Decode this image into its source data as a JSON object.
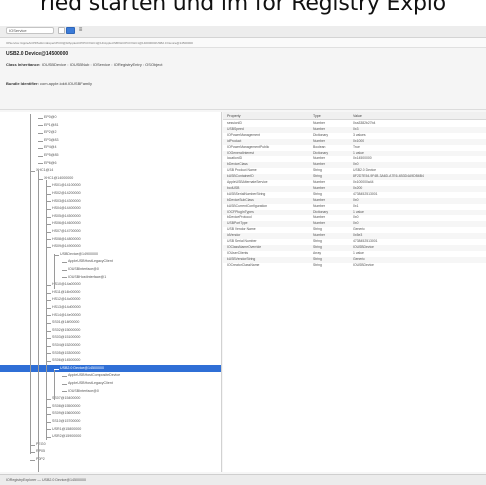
{
  "banner": {
    "text": "ried starten und im for Registry Explo"
  },
  "window": {
    "title": "IORegistryExplorer — IOService"
  },
  "toolbar": {
    "search": "IOService",
    "btn_c": "≡"
  },
  "path_bar": "IOService:/AppleACPIPlatformExpert/PCI0@0/AppleACPIPCI/XHC1@14/AppleUSBXHCIPCI/XHC1@14000000/USB2.0 Device@14500000",
  "device": {
    "title": "USB2.0 Device@14500000",
    "class_label": "Class Inheritance:",
    "class_value": "IOUSBDevice : IOUSBNub : IOService : IORegistryEntry : OSObject",
    "bundle_label": "Bundle Identifier:",
    "bundle_value": "com.apple.iokit.IOUSBFamily"
  },
  "tree": [
    {
      "label": "EP0@0",
      "level": 2
    },
    {
      "label": "EP1@81",
      "level": 2
    },
    {
      "label": "EP2@2",
      "level": 2
    },
    {
      "label": "EP3@83",
      "level": 2
    },
    {
      "label": "EP4@4",
      "level": 2
    },
    {
      "label": "EP5@85",
      "level": 2
    },
    {
      "label": "EP6@6",
      "level": 2
    },
    {
      "label": "XHC1@14",
      "level": 1
    },
    {
      "label": "XHC1@14000000",
      "level": 2
    },
    {
      "label": "HS01@14100000",
      "level": 3
    },
    {
      "label": "HS02@14200000",
      "level": 3
    },
    {
      "label": "HS03@14300000",
      "level": 3
    },
    {
      "label": "HS04@14400000",
      "level": 3
    },
    {
      "label": "HS05@14500000",
      "level": 3
    },
    {
      "label": "HS06@14600000",
      "level": 3
    },
    {
      "label": "HS07@14700000",
      "level": 3
    },
    {
      "label": "HS08@14800000",
      "level": 3
    },
    {
      "label": "HS09@14900000",
      "level": 3
    },
    {
      "label": "USBDevice@14900000",
      "level": 4
    },
    {
      "label": "AppleUSBHostLegacyClient",
      "level": 5
    },
    {
      "label": "IOUSBInterface@0",
      "level": 5
    },
    {
      "label": "IOUSBHostInterface@1",
      "level": 5
    },
    {
      "label": "HS10@14a00000",
      "level": 3
    },
    {
      "label": "HS11@14b00000",
      "level": 3
    },
    {
      "label": "HS12@14c00000",
      "level": 3
    },
    {
      "label": "HS13@14d00000",
      "level": 3
    },
    {
      "label": "HS14@14e00000",
      "level": 3
    },
    {
      "label": "SS01@14f00000",
      "level": 3
    },
    {
      "label": "SS02@15000000",
      "level": 3
    },
    {
      "label": "SS03@15100000",
      "level": 3
    },
    {
      "label": "SS04@15200000",
      "level": 3
    },
    {
      "label": "SS05@15300000",
      "level": 3
    },
    {
      "label": "SS06@14500000",
      "level": 3
    },
    {
      "label": "USB2.0 Device@14500000",
      "level": 4,
      "selected": true
    },
    {
      "label": "AppleUSBHostCompositeDevice",
      "level": 5
    },
    {
      "label": "AppleUSBHostLegacyClient",
      "level": 5
    },
    {
      "label": "IOUSBInterface@0",
      "level": 5
    },
    {
      "label": "SS07@15400000",
      "level": 3
    },
    {
      "label": "SS08@15500000",
      "level": 3
    },
    {
      "label": "SS09@15600000",
      "level": 3
    },
    {
      "label": "SS10@15700000",
      "level": 3
    },
    {
      "label": "USR1@15800000",
      "level": 3
    },
    {
      "label": "USR2@15900000",
      "level": 3
    },
    {
      "label": "PEG0",
      "level": 1
    },
    {
      "label": "RP05",
      "level": 1
    },
    {
      "label": "P0P2",
      "level": 1
    }
  ],
  "props": {
    "headers": [
      "Property",
      "Type",
      "Value"
    ],
    "rows": [
      [
        "sessionID",
        "Number",
        "0xa3382b27b4"
      ],
      [
        "USBSpeed",
        "Number",
        "0x3"
      ],
      [
        "IOPowerManagement",
        "Dictionary",
        "3 values"
      ],
      [
        "idProduct",
        "Number",
        "0x1000"
      ],
      [
        "IOPowerManagementPublic",
        "Boolean",
        "True"
      ],
      [
        "IOGeneralInterest",
        "Dictionary",
        "1 value"
      ],
      [
        "locationID",
        "Number",
        "0x14500000"
      ],
      [
        "bDeviceClass",
        "Number",
        "0x0"
      ],
      [
        "USB Product Name",
        "String",
        "USB2.0 Device"
      ],
      [
        "kUSBContainerID",
        "String",
        "8F2D7E54-9F4B-3A6D-A7E6-4B3D4A9DB6B4"
      ],
      [
        "AppleUSBAlternateService",
        "Number",
        "0x100000a44"
      ],
      [
        "bcdUSB",
        "Number",
        "0x200"
      ],
      [
        "kUSBSerialNumberString",
        "String",
        "4738452513001"
      ],
      [
        "bDeviceSubClass",
        "Number",
        "0x0"
      ],
      [
        "kUSBCurrentConfiguration",
        "Number",
        "0x1"
      ],
      [
        "IOCFPlugInTypes",
        "Dictionary",
        "1 value"
      ],
      [
        "bDeviceProtocol",
        "Number",
        "0x0"
      ],
      [
        "USBPortType",
        "Number",
        "0x0"
      ],
      [
        "USB Vendor Name",
        "String",
        "Generic"
      ],
      [
        "idVendor",
        "Number",
        "0x5e3"
      ],
      [
        "USB Serial Number",
        "String",
        "4738452513001"
      ],
      [
        "IOClassNameOverride",
        "String",
        "IOUSBDevice"
      ],
      [
        "IOUserClients",
        "Array",
        "1 value"
      ],
      [
        "kUSBVendorString",
        "String",
        "Generic"
      ],
      [
        "IOCreatorClassName",
        "String",
        "IOUSBDevice"
      ]
    ]
  },
  "status": "IORegistryExplorer — USB2.0 Device@14500000"
}
